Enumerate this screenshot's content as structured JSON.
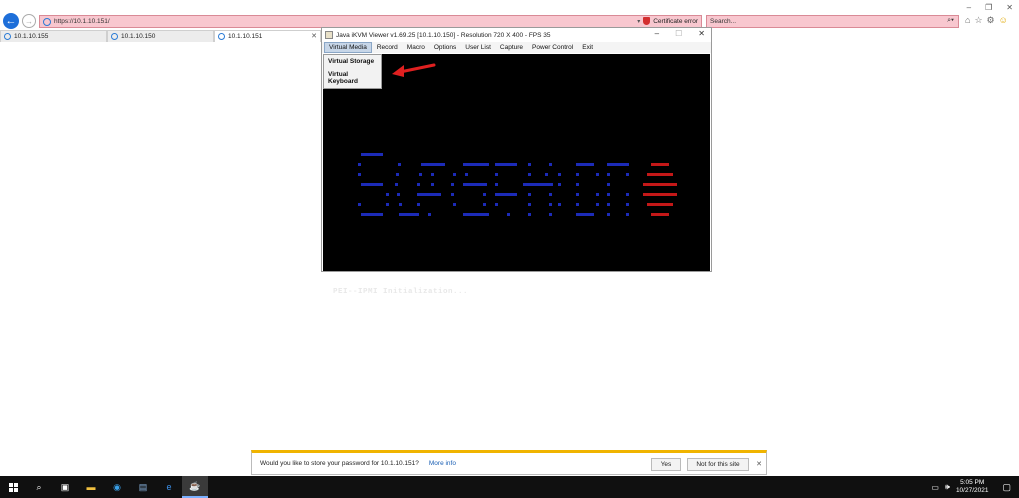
{
  "browser": {
    "url": "https://10.1.10.151/",
    "cert_error": "Certificate error",
    "search_placeholder": "Search...",
    "tabs": [
      {
        "label": "10.1.10.155"
      },
      {
        "label": "10.1.10.150"
      },
      {
        "label": "10.1.10.151"
      }
    ]
  },
  "kvm": {
    "title": "Java iKVM Viewer v1.69.25 [10.1.10.150]  - Resolution 720 X 400 - FPS 35",
    "menu": [
      "Virtual Media",
      "Record",
      "Macro",
      "Options",
      "User List",
      "Capture",
      "Power Control",
      "Exit"
    ],
    "dropdown": [
      "Virtual Storage",
      "Virtual Keyboard"
    ],
    "console_text": "PEI--IPMI Initialization..."
  },
  "notification": {
    "message": "Would you like to store your password for 10.1.10.151?",
    "more_info": "More info",
    "yes": "Yes",
    "no": "Not for this site"
  },
  "taskbar": {
    "time": "5:05 PM",
    "date": "10/27/2021"
  },
  "colors": {
    "accent": "#1e6fd9",
    "address_error": "#f8c7cf",
    "logo_blue": "#1c2bb8",
    "logo_red": "#c41818",
    "annotation_arrow": "#e02020"
  }
}
